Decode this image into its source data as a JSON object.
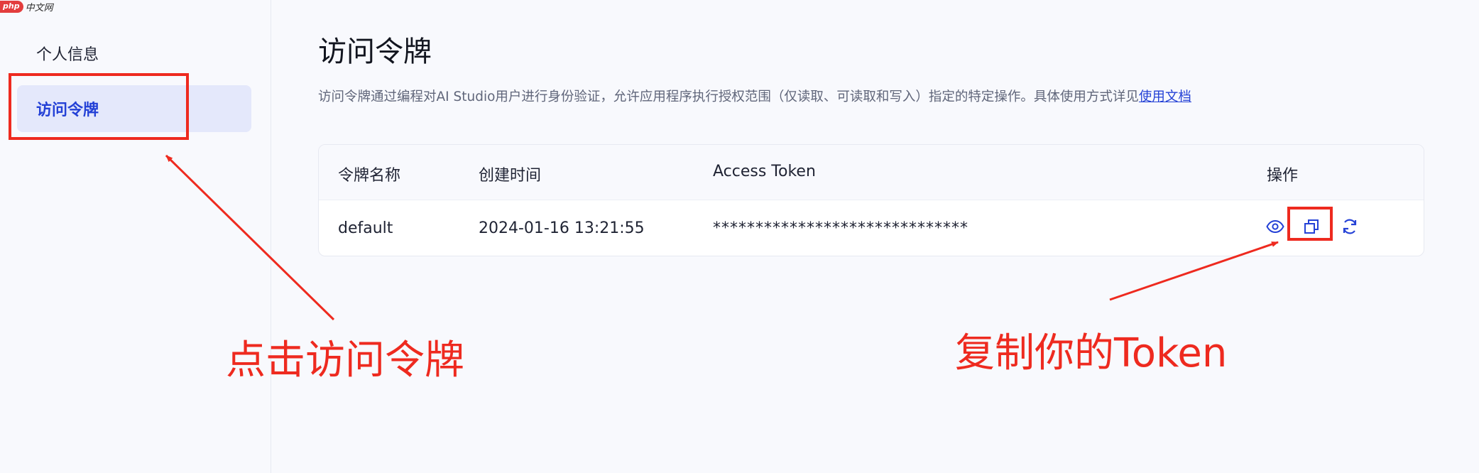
{
  "watermark": {
    "badge": "php",
    "text": "中文网"
  },
  "sidebar": {
    "items": [
      {
        "label": "个人信息"
      },
      {
        "label": "访问令牌"
      }
    ]
  },
  "main": {
    "title": "访问令牌",
    "description": "访问令牌通过编程对AI Studio用户进行身份验证，允许应用程序执行授权范围（仅读取、可读取和写入）指定的特定操作。具体使用方式详见",
    "doc_link": "使用文档"
  },
  "table": {
    "headers": [
      "令牌名称",
      "创建时间",
      "Access Token",
      "操作"
    ],
    "rows": [
      {
        "name": "default",
        "created": "2024-01-16 13:21:55",
        "token": "******************************"
      }
    ],
    "actions": [
      "eye-icon",
      "copy-icon",
      "refresh-icon"
    ]
  },
  "annotations": {
    "left_text": "点击访问令牌",
    "right_text": "复制你的Token"
  },
  "colors": {
    "accent": "#2441d6",
    "annotation": "#ee2a1f",
    "active_bg": "#e4e8fb"
  }
}
